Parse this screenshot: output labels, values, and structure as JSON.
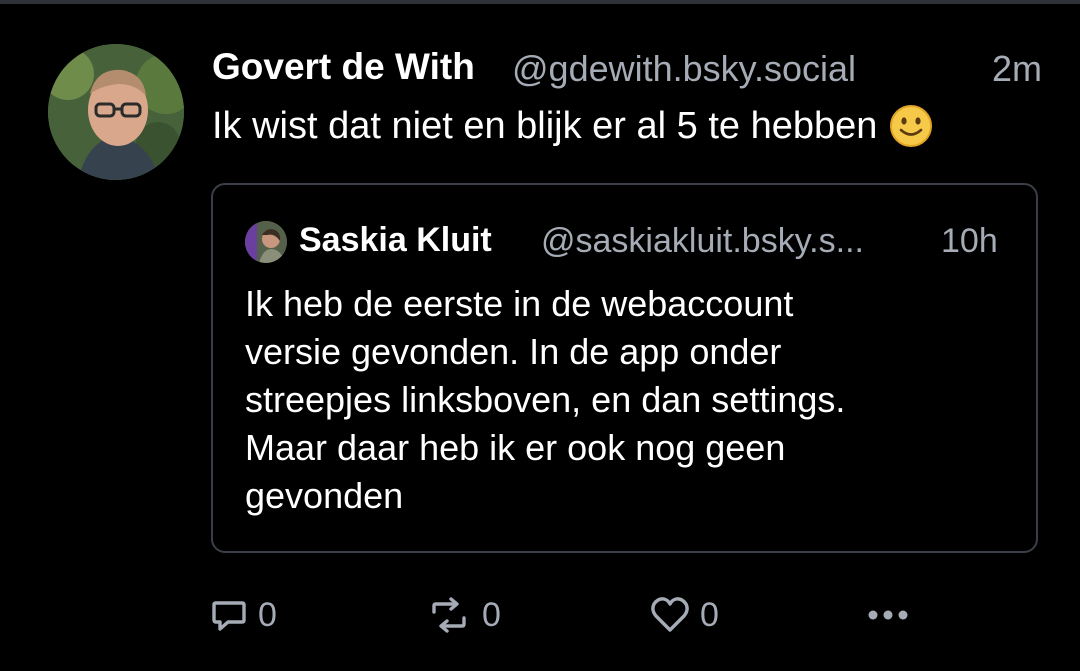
{
  "post": {
    "author_name": "Govert de With",
    "author_handle": "@gdewith.bsky.social",
    "timestamp": "2m",
    "text": "Ik wist dat niet en blijk er al 5 te hebben",
    "emoji_icon": "slightly-smiling-face-icon"
  },
  "quote": {
    "author_name": "Saskia Kluit",
    "author_handle": "@saskiakluit.bsky.s...",
    "timestamp": "10h",
    "lines": [
      "Ik heb de eerste in de webaccount",
      "versie gevonden. In de app onder",
      "streepjes linksboven, en dan settings.",
      "Maar daar heb ik er ook nog geen",
      "gevonden"
    ]
  },
  "actions": {
    "reply_count": "0",
    "repost_count": "0",
    "like_count": "0",
    "reply_icon": "reply-icon",
    "repost_icon": "repost-icon",
    "like_icon": "heart-icon",
    "more_icon": "more-icon"
  },
  "colors": {
    "background": "#000000",
    "secondary_text": "#a6acb6",
    "border": "#3a3f47"
  }
}
